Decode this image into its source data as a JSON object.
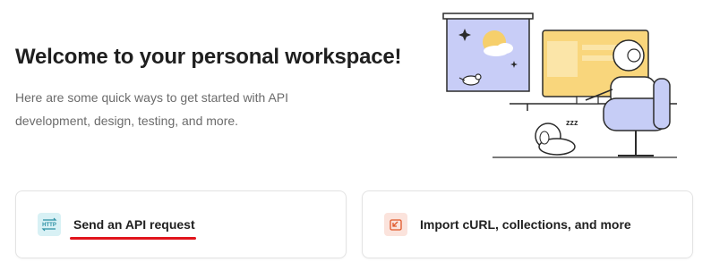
{
  "hero": {
    "title": "Welcome to your personal workspace!",
    "subtitle": "Here are some quick ways to get started with API development, design, testing, and more."
  },
  "cards": [
    {
      "label": "Send an API request",
      "icon": "http-icon",
      "accent": "#d8f1f5",
      "icon_text": "HTTP"
    },
    {
      "label": "Import cURL, collections, and more",
      "icon": "import-icon",
      "accent": "#fbe3dc"
    }
  ],
  "colors": {
    "underline": "#e1141c",
    "http_icon": "#2a8fa3",
    "import_icon": "#e0572a"
  },
  "illustration": {
    "sleep_text": "zzz"
  }
}
